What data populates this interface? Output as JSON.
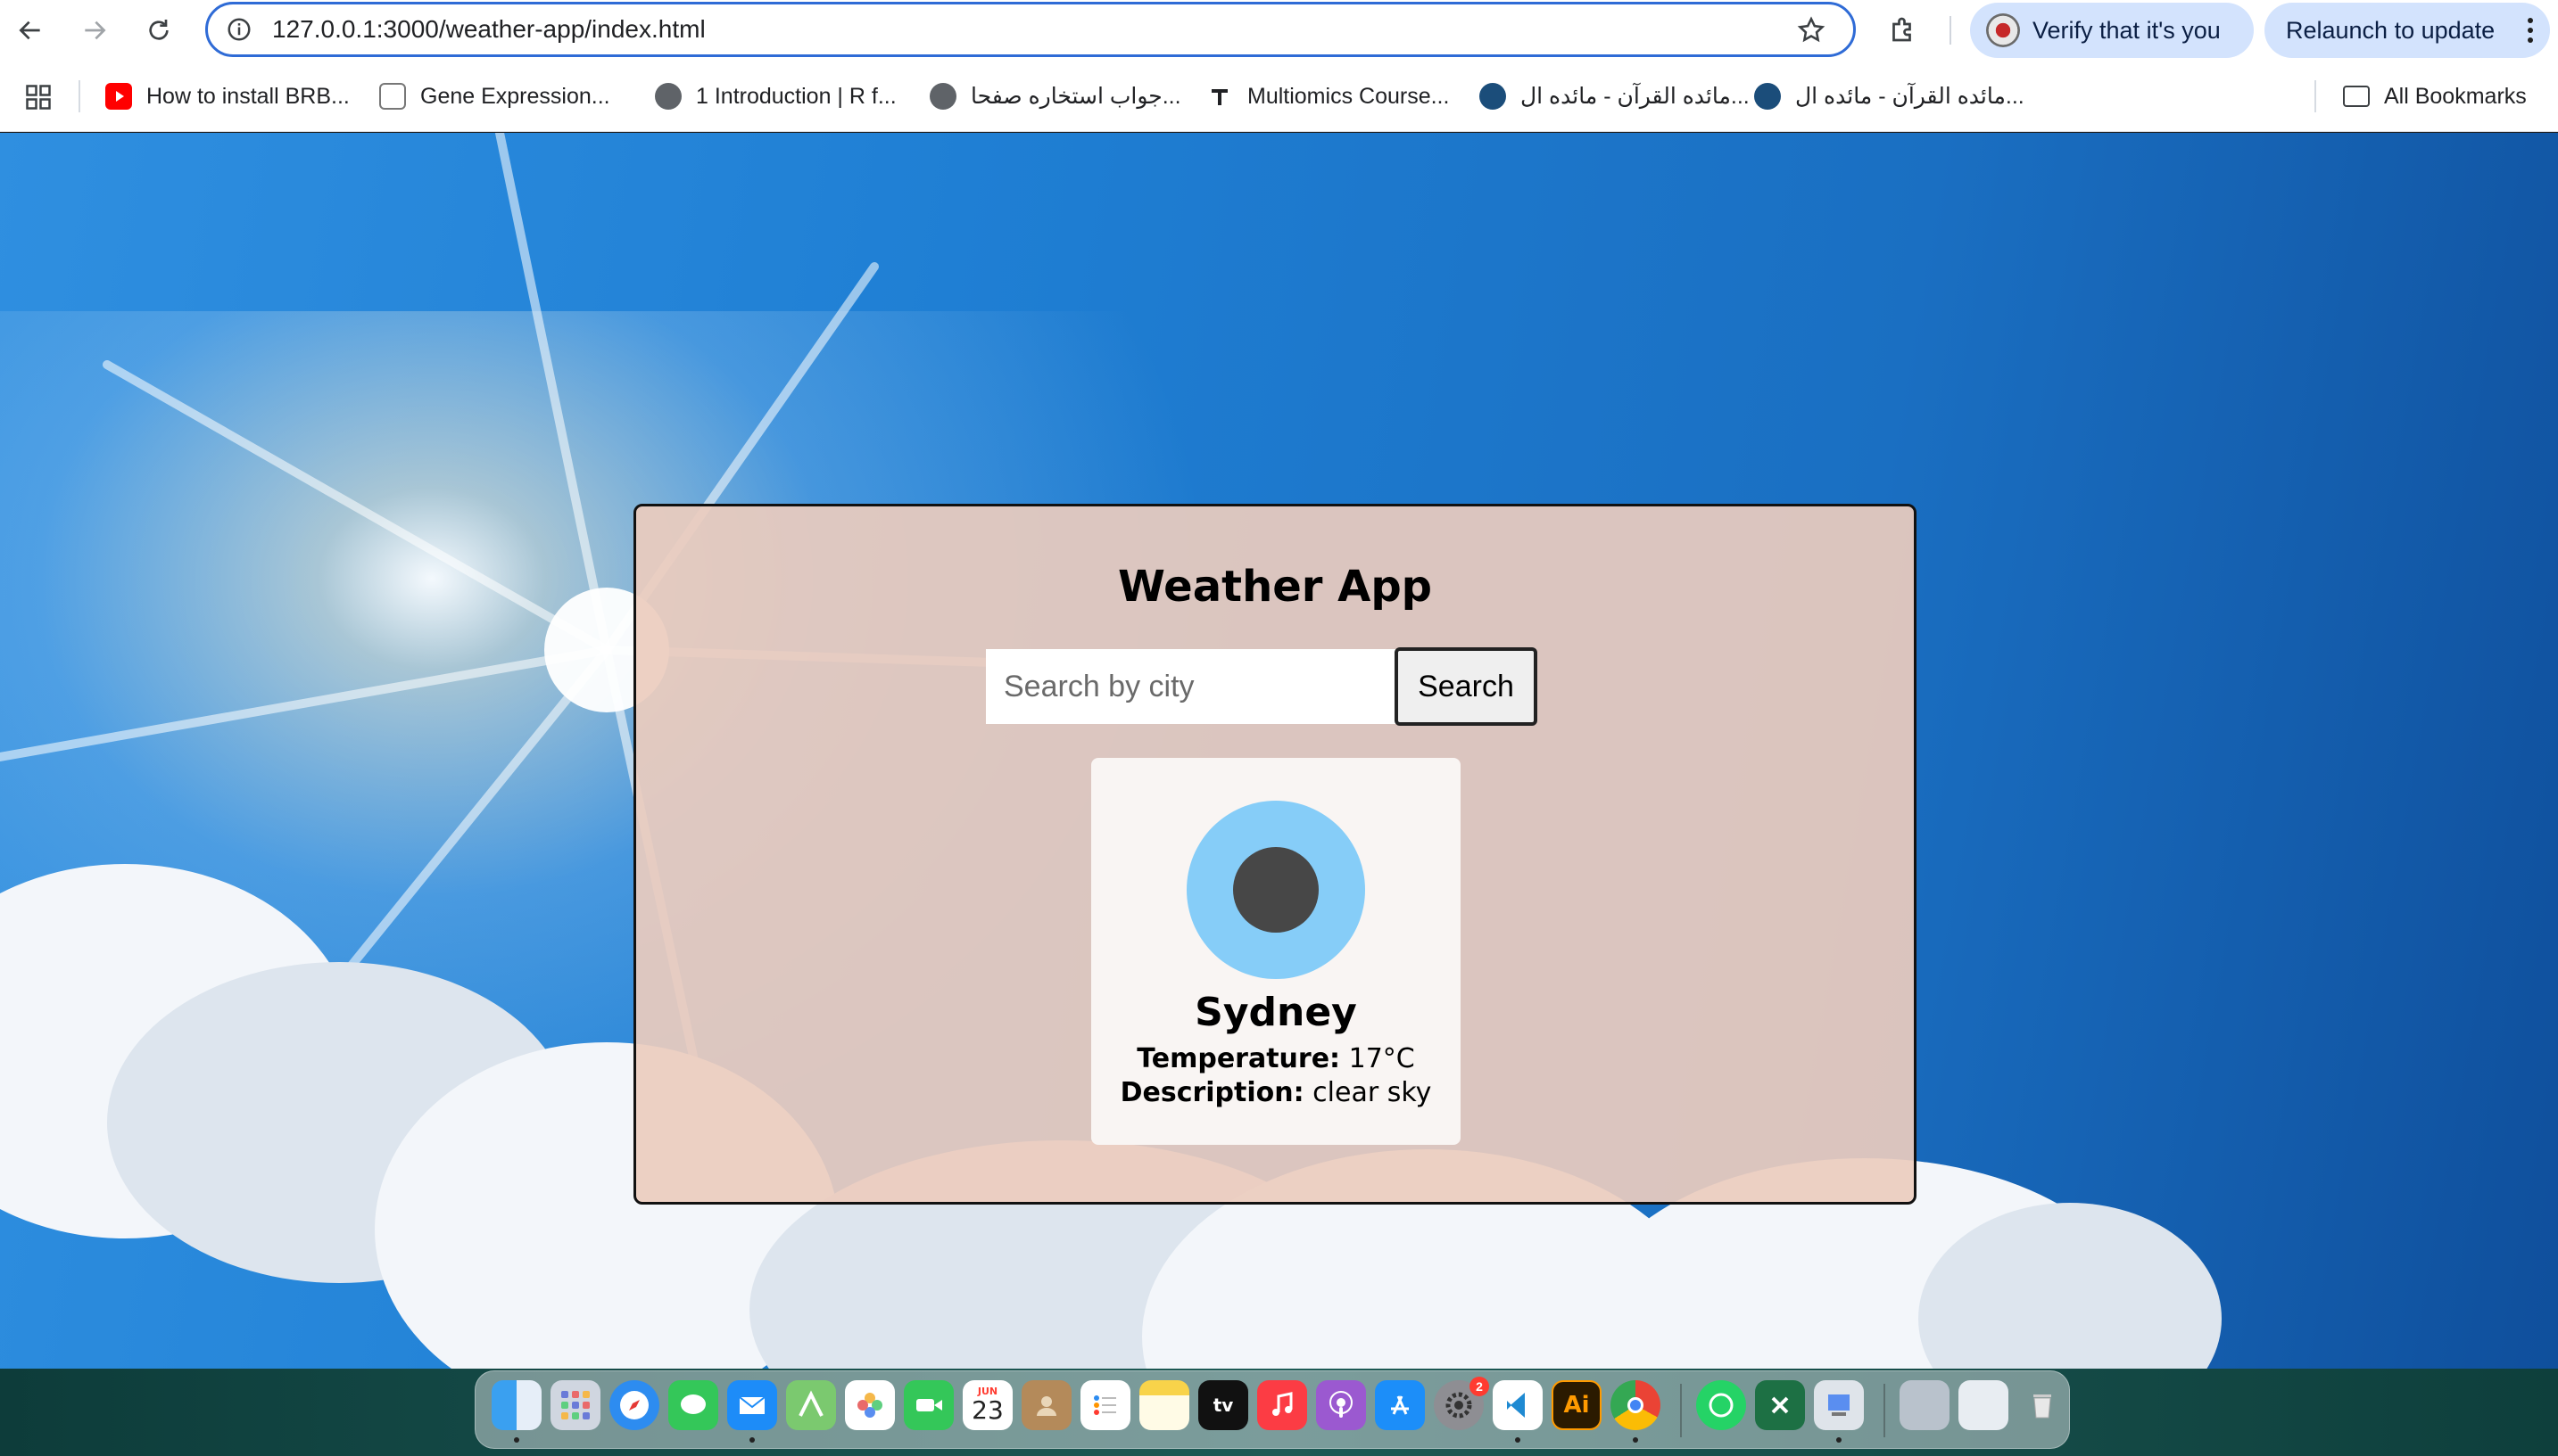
{
  "browser": {
    "url": "127.0.0.1:3000/weather-app/index.html",
    "verify_label": "Verify that it's you",
    "relaunch_label": "Relaunch to update"
  },
  "bookmarks": {
    "items": [
      {
        "label": "How to install BRB...",
        "icon": "youtube-icon"
      },
      {
        "label": "Gene Expression...",
        "icon": "presentation-icon"
      },
      {
        "label": "1 Introduction | R f...",
        "icon": "globe-icon"
      },
      {
        "label": "جواب استخاره صفحا...",
        "icon": "globe-icon"
      },
      {
        "label": "Multiomics Course...",
        "icon": "bookmark-t-icon"
      },
      {
        "label": "مائده القرآن - مائده ال...",
        "icon": "quran-icon"
      },
      {
        "label": "مائده القرآن - مائده ال...",
        "icon": "quran-icon"
      }
    ],
    "all_bookmarks_label": "All Bookmarks"
  },
  "app": {
    "title": "Weather App",
    "search_placeholder": "Search by city",
    "search_button": "Search",
    "result": {
      "city": "Sydney",
      "temperature_label": "Temperature:",
      "temperature_value": "17°C",
      "description_label": "Description:",
      "description_value": "clear sky"
    }
  },
  "dock": {
    "calendar_month": "JUN",
    "calendar_day": "23",
    "tv_label": "tv",
    "illustrator_label": "Ai",
    "settings_badge": "2"
  }
}
